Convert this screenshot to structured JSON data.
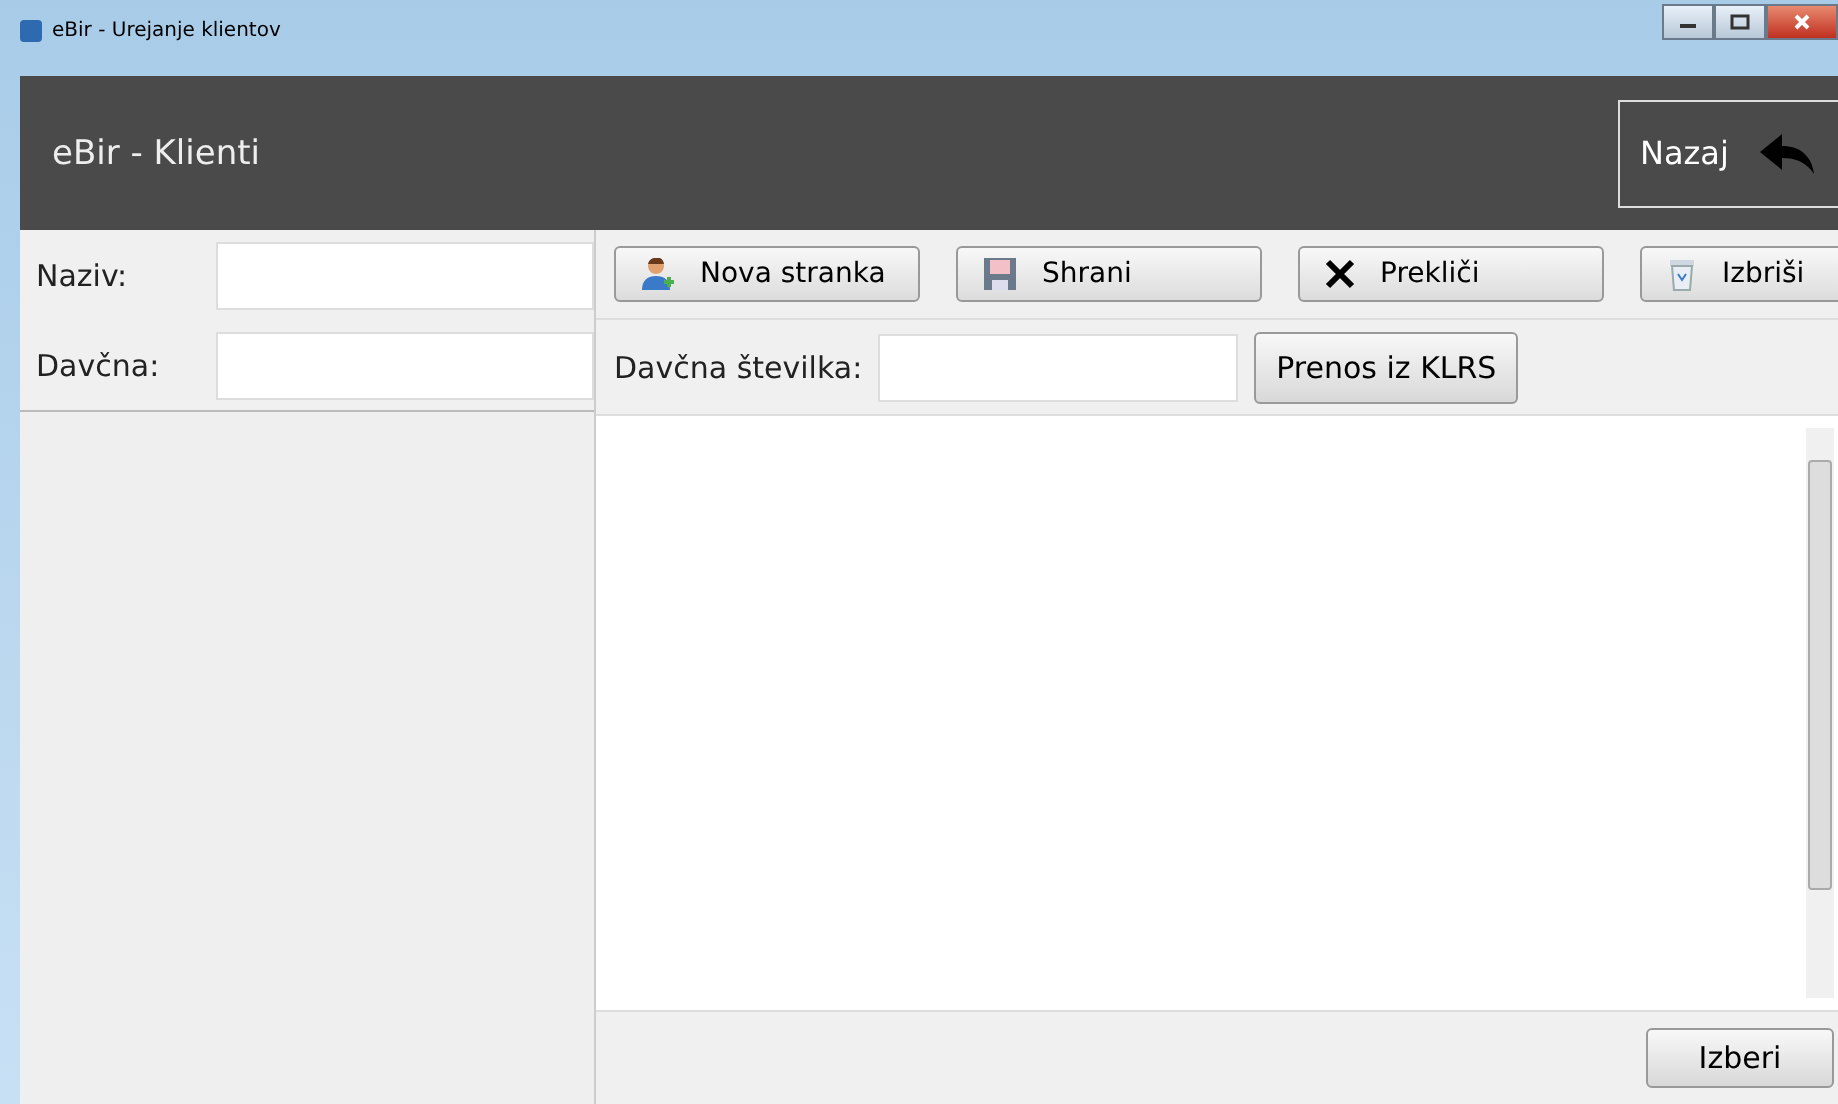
{
  "window": {
    "title": "eBir - Urejanje klientov"
  },
  "header": {
    "title": "eBir - Klienti",
    "back_button": "Nazaj"
  },
  "filters": [
    {
      "label": "Naziv:"
    },
    {
      "label": "Davčna:"
    }
  ],
  "toolbar": [
    {
      "label": "Nova stranka",
      "kind": "person"
    },
    {
      "label": "Shrani",
      "kind": "save"
    },
    {
      "label": "Prekliči",
      "kind": "cancel"
    },
    {
      "label": "Izbriši",
      "kind": "delete"
    }
  ],
  "tax_field": {
    "label": "Davčna številka:"
  },
  "import_button": "Prenos iz KLRS",
  "select_button": "Izberi"
}
